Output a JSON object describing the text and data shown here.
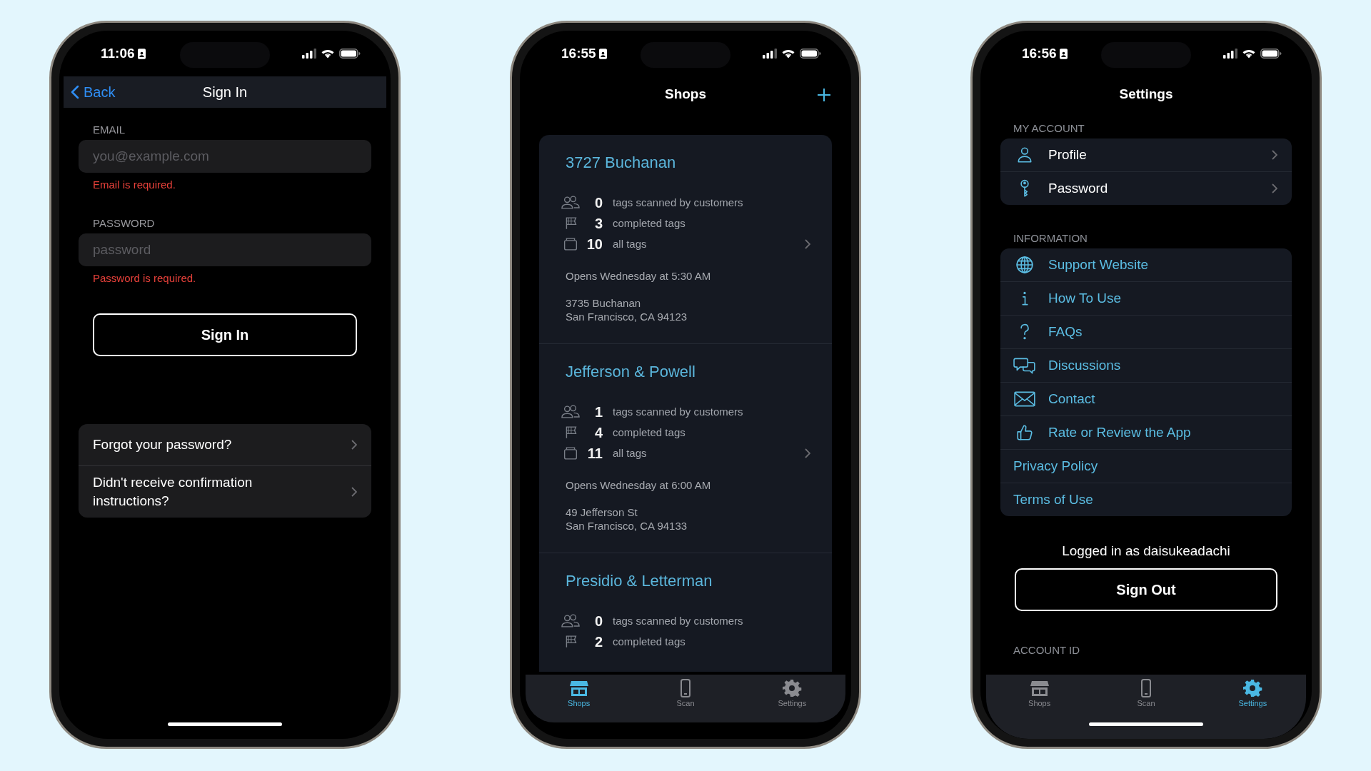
{
  "phones": [
    {
      "kind": "sign_in",
      "home_indicator": true,
      "status_bar": {
        "time": "11:06"
      },
      "nav_bar": {
        "back": "Back",
        "title": "Sign In"
      },
      "fields": [
        {
          "label": "EMAIL",
          "placeholder": "you@example.com",
          "error": "Email is required."
        },
        {
          "label": "PASSWORD",
          "placeholder": "password",
          "error": "Password is required."
        }
      ],
      "primary_button": "Sign In",
      "links": [
        "Forgot your password?",
        "Didn't receive confirmation instructions?"
      ]
    },
    {
      "kind": "shops",
      "home_indicator": false,
      "status_bar": {
        "time": "16:55"
      },
      "title": "Shops",
      "shops": [
        {
          "name": "3727 Buchanan",
          "stats": [
            {
              "count": "0",
              "text": "tags scanned by customers"
            },
            {
              "count": "3",
              "text": "completed tags"
            },
            {
              "count": "10",
              "text": "all tags"
            }
          ],
          "hours": "Opens Wednesday at 5:30 AM",
          "address": [
            "3735 Buchanan",
            "San Francisco, CA 94123"
          ]
        },
        {
          "name": "Jefferson & Powell",
          "stats": [
            {
              "count": "1",
              "text": "tags scanned by customers"
            },
            {
              "count": "4",
              "text": "completed tags"
            },
            {
              "count": "11",
              "text": "all tags"
            }
          ],
          "hours": "Opens Wednesday at 6:00 AM",
          "address": [
            "49 Jefferson St",
            "San Francisco, CA 94133"
          ]
        },
        {
          "name": "Presidio & Letterman",
          "stats": [
            {
              "count": "0",
              "text": "tags scanned by customers"
            },
            {
              "count": "2",
              "text": "completed tags"
            }
          ]
        }
      ],
      "tab_bar": [
        {
          "label": "Shops",
          "selected": true
        },
        {
          "label": "Scan",
          "selected": false
        },
        {
          "label": "Settings",
          "selected": false
        }
      ]
    },
    {
      "kind": "settings",
      "home_indicator": true,
      "status_bar": {
        "time": "16:56"
      },
      "title": "Settings",
      "sections": [
        {
          "header": "MY ACCOUNT",
          "kind": "navigation",
          "items": [
            "Profile",
            "Password"
          ]
        },
        {
          "header": "INFORMATION",
          "kind": "links",
          "items": [
            "Support Website",
            "How To Use",
            "FAQs",
            "Discussions",
            "Contact",
            "Rate or Review the App",
            "Privacy Policy",
            "Terms of Use"
          ]
        }
      ],
      "logged_in": "Logged in as daisukeadachi",
      "sign_out": "Sign Out",
      "footer_header": "ACCOUNT ID",
      "tab_bar": [
        {
          "label": "Shops",
          "selected": false
        },
        {
          "label": "Scan",
          "selected": false
        },
        {
          "label": "Settings",
          "selected": true
        }
      ]
    }
  ]
}
